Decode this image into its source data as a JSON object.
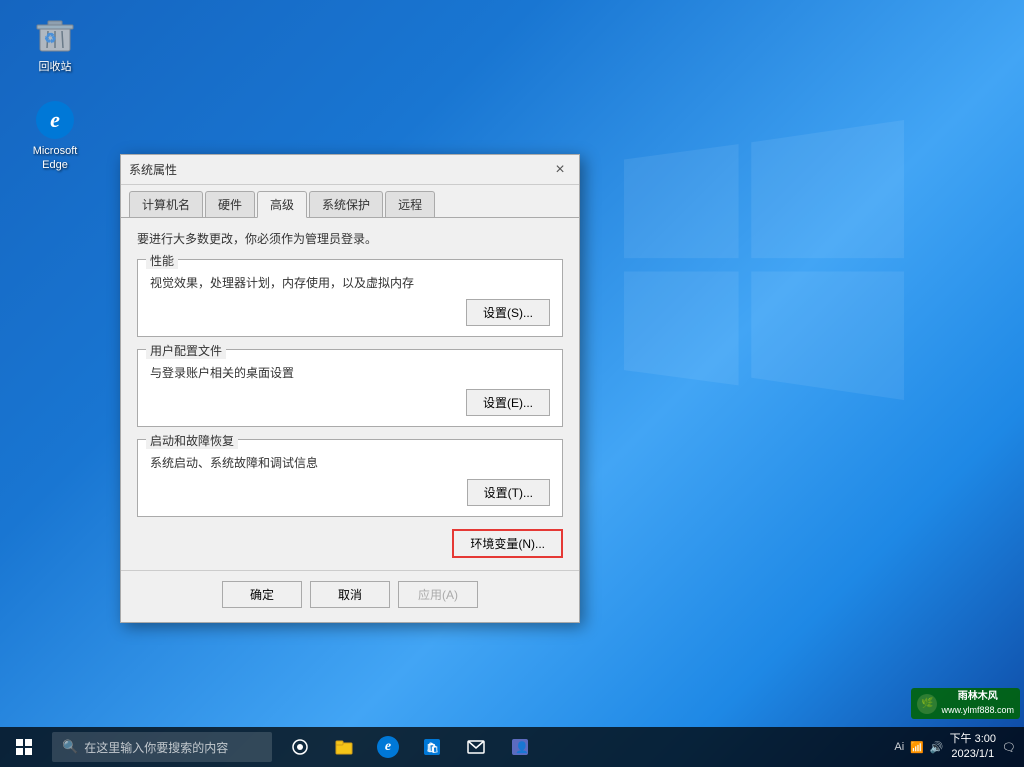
{
  "desktop": {
    "bg_note": "Windows 10 blue gradient",
    "icons": [
      {
        "id": "recycle-bin",
        "label": "回收站",
        "type": "recycle"
      },
      {
        "id": "edge",
        "label": "Microsoft\nEdge",
        "type": "edge"
      }
    ]
  },
  "dialog": {
    "title": "系统属性",
    "close_label": "×",
    "tabs": [
      {
        "id": "computer-name",
        "label": "计算机名",
        "active": false
      },
      {
        "id": "hardware",
        "label": "硬件",
        "active": false
      },
      {
        "id": "advanced",
        "label": "高级",
        "active": true
      },
      {
        "id": "system-protection",
        "label": "系统保护",
        "active": false
      },
      {
        "id": "remote",
        "label": "远程",
        "active": false
      }
    ],
    "note": "要进行大多数更改，你必须作为管理员登录。",
    "sections": [
      {
        "id": "performance",
        "label": "性能",
        "desc": "视觉效果，处理器计划，内存使用，以及虚拟内存",
        "btn": "设置(S)..."
      },
      {
        "id": "user-profiles",
        "label": "用户配置文件",
        "desc": "与登录账户相关的桌面设置",
        "btn": "设置(E)..."
      },
      {
        "id": "startup-recovery",
        "label": "启动和故障恢复",
        "desc": "系统启动、系统故障和调试信息",
        "btn": "设置(T)..."
      }
    ],
    "env_btn": "环境变量(N)...",
    "footer": {
      "ok": "确定",
      "cancel": "取消",
      "apply": "应用(A)"
    }
  },
  "taskbar": {
    "search_placeholder": "在这里输入你要搜索的内容",
    "tray_text": "Ai",
    "watermark_line1": "雨林木风",
    "watermark_line2": "www.ylmf888.com"
  }
}
